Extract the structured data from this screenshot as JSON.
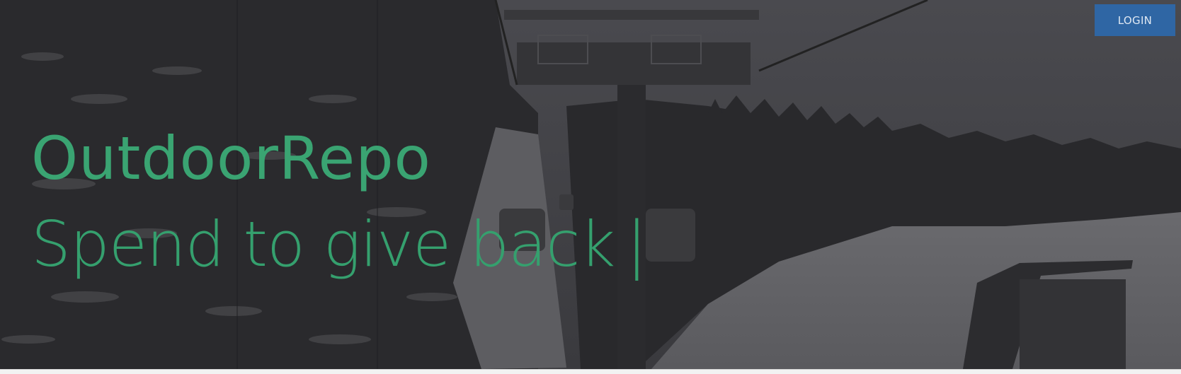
{
  "header": {
    "login_label": "LOGIN"
  },
  "hero": {
    "title": "OutdoorRepo",
    "tagline": "Spend to give back",
    "cursor": "|"
  },
  "colors": {
    "brand_green": "#3aa472",
    "login_blue": "#2f66a4",
    "overlay_dark": "#2f2f33"
  }
}
